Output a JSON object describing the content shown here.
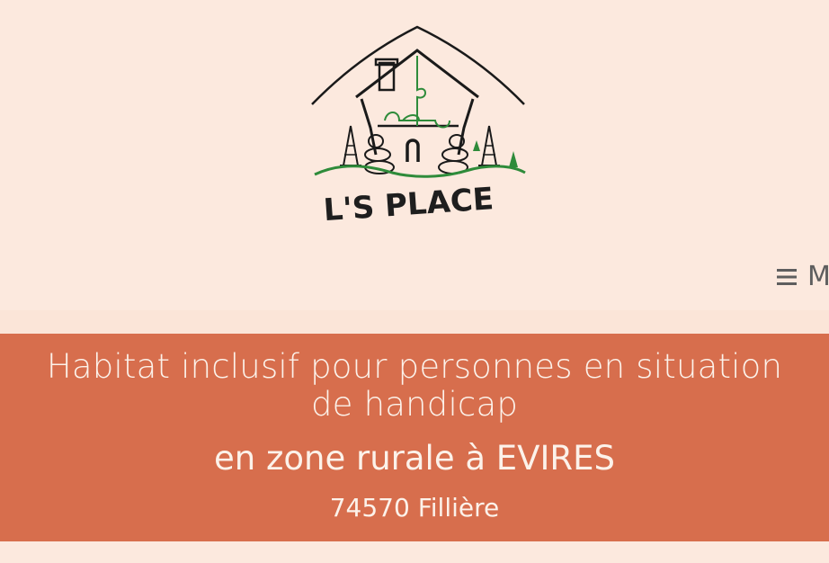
{
  "site": {
    "logo_text": "L'S PLACE",
    "menu_label": "M"
  },
  "banner": {
    "title_line1": "Habitat inclusif pour personnes en situation de handicap",
    "title_line2": "en zone rurale à EVIRES",
    "subtitle": "74570 Fillière"
  },
  "colors": {
    "page_bg": "#fce9de",
    "banner_bg": "#d76e4d",
    "banner_text": "#fcf2ea",
    "logo_green": "#2e8b3a"
  },
  "icons": {
    "menu": "hamburger-icon"
  }
}
